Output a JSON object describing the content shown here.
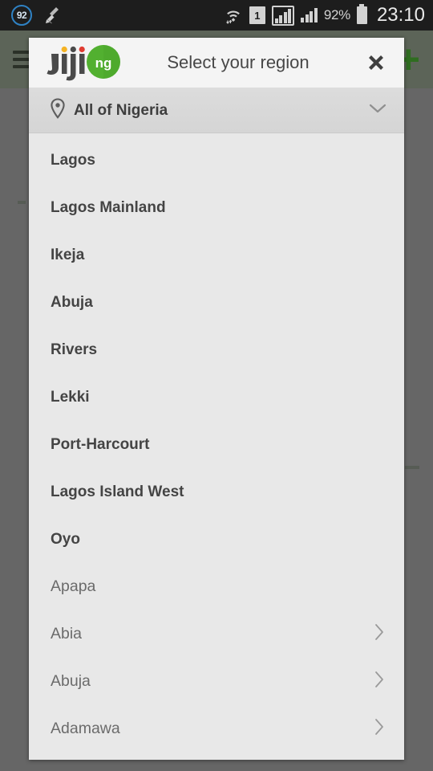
{
  "statusbar": {
    "cleaner_badge": "92",
    "broom_icon": "broom-icon",
    "wifi_icon": "wifi-icon",
    "sim_label": "1",
    "signal_icon_primary": "signal-bars-boxed-icon",
    "signal_icon_secondary": "signal-bars-icon",
    "battery_percent": "92%",
    "battery_icon": "battery-full-icon",
    "clock": "23:10"
  },
  "appbar": {
    "menu_icon": "hamburger-menu-icon",
    "add_icon": "plus-icon",
    "add_label": "+",
    "background_color": "#5c6458"
  },
  "dialog": {
    "logo": {
      "icon": "jiji-ng-logo",
      "wordmark": "Jiji",
      "suffix": "ng",
      "green": "#52b030",
      "dark": "#4a4a4a",
      "yellow": "#f5b324",
      "red": "#e03c31"
    },
    "title": "Select your region",
    "close_icon": "close-icon",
    "close_label": "✕",
    "current_region": {
      "pin_icon": "location-pin-icon",
      "label": "All of Nigeria",
      "expand_icon": "chevron-down-icon"
    },
    "items": [
      {
        "label": "Lagos",
        "bold": true,
        "chevron": false
      },
      {
        "label": "Lagos Mainland",
        "bold": true,
        "chevron": false
      },
      {
        "label": "Ikeja",
        "bold": true,
        "chevron": false
      },
      {
        "label": "Abuja",
        "bold": true,
        "chevron": false
      },
      {
        "label": "Rivers",
        "bold": true,
        "chevron": false
      },
      {
        "label": "Lekki",
        "bold": true,
        "chevron": false
      },
      {
        "label": "Port-Harcourt",
        "bold": true,
        "chevron": false
      },
      {
        "label": "Lagos Island West",
        "bold": true,
        "chevron": false
      },
      {
        "label": "Oyo",
        "bold": true,
        "chevron": false
      },
      {
        "label": "Apapa",
        "bold": false,
        "chevron": false
      },
      {
        "label": "Abia",
        "bold": false,
        "chevron": true
      },
      {
        "label": "Abuja",
        "bold": false,
        "chevron": true
      },
      {
        "label": "Adamawa",
        "bold": false,
        "chevron": true
      }
    ],
    "chevron_right_icon": "chevron-right-icon",
    "background_color": "#e8e8e8"
  },
  "scrim_color": "#666666"
}
